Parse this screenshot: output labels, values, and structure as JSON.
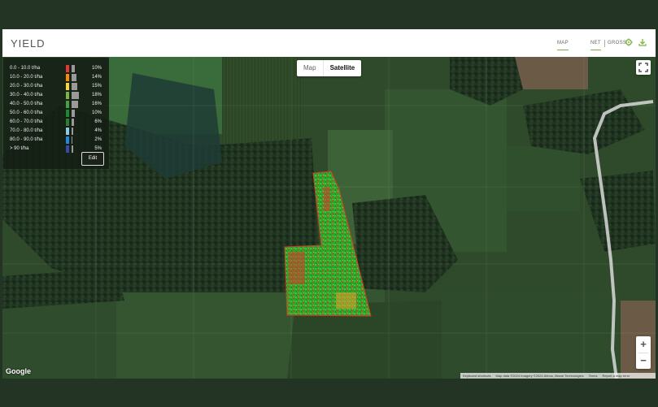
{
  "header": {
    "title": "YIELD",
    "tab_map": "MAP",
    "tab_net": "NET",
    "tab_gross": "GROSS",
    "settings_icon": "gear-icon",
    "download_icon": "download-icon"
  },
  "legend": {
    "items": [
      {
        "label": "0.0 - 10.0 t/ha",
        "color": "#e53935",
        "percent": "10%",
        "value": 10
      },
      {
        "label": "10.0 - 20.0 t/ha",
        "color": "#fb8c00",
        "percent": "14%",
        "value": 14
      },
      {
        "label": "20.0 - 30.0 t/ha",
        "color": "#fdd835",
        "percent": "15%",
        "value": 15
      },
      {
        "label": "30.0 - 40.0 t/ha",
        "color": "#7cb342",
        "percent": "18%",
        "value": 18
      },
      {
        "label": "40.0 - 50.0 t/ha",
        "color": "#43a047",
        "percent": "16%",
        "value": 16
      },
      {
        "label": "50.0 - 60.0 t/ha",
        "color": "#1b8a2e",
        "percent": "10%",
        "value": 10
      },
      {
        "label": "60.0 - 70.0 t/ha",
        "color": "#2e7d32",
        "percent": "6%",
        "value": 6
      },
      {
        "label": "70.0 - 80.0 t/ha",
        "color": "#8ec9e6",
        "percent": "4%",
        "value": 4
      },
      {
        "label": "80.0 - 90.0 t/ha",
        "color": "#1e88e5",
        "percent": "2%",
        "value": 2
      },
      {
        "label": "> 90 t/ha",
        "color": "#3949ab",
        "percent": "5%",
        "value": 5
      }
    ],
    "edit_label": "Edit"
  },
  "map": {
    "type_map": "Map",
    "type_satellite": "Satellite",
    "selected_type": "Satellite",
    "fullscreen_icon": "fullscreen-icon",
    "zoom_in": "+",
    "zoom_out": "−",
    "google_logo": "Google",
    "attribution": {
      "shortcuts": "Keyboard shortcuts",
      "data": "Map data ©2024 Imagery ©2024 Airbus, Maxar Technologies",
      "terms": "Terms",
      "report": "Report a map error"
    }
  },
  "colors": {
    "page_bg": "#243424",
    "accent": "#7cb342"
  }
}
